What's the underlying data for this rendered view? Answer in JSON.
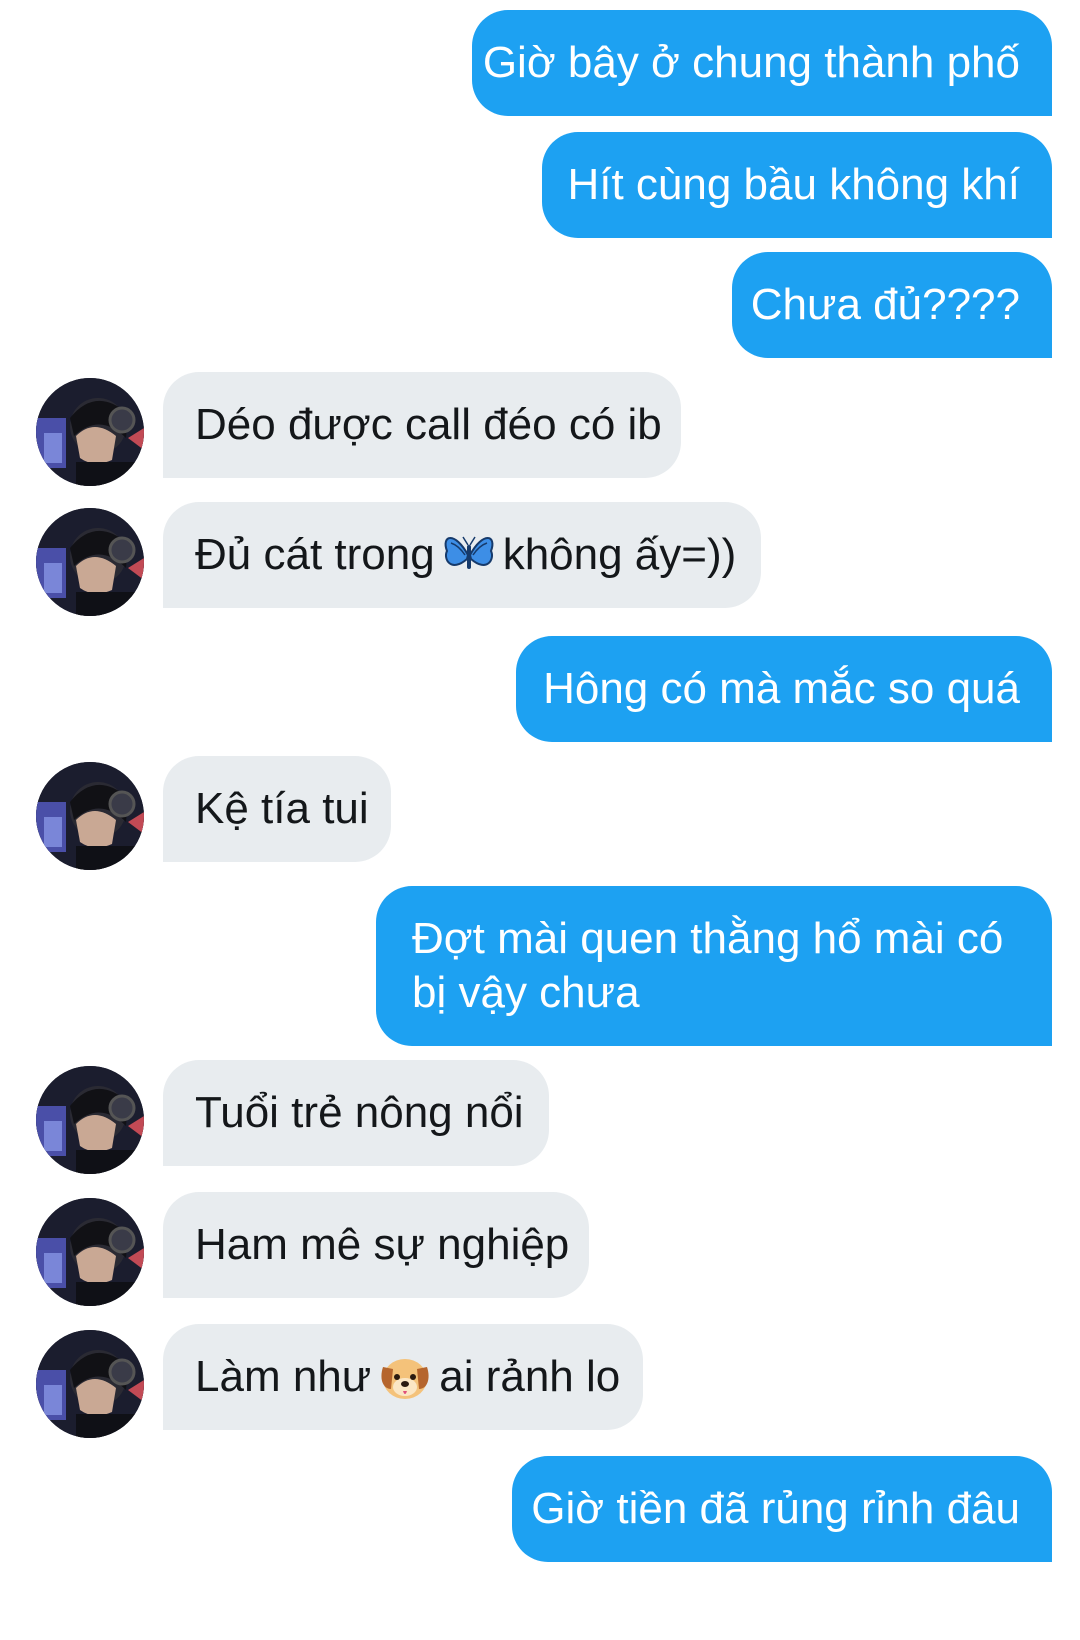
{
  "conversation": {
    "messages": [
      {
        "side": "out",
        "text": "Giờ bây ở chung thành phố"
      },
      {
        "side": "out",
        "text": "Hít cùng bầu không khí"
      },
      {
        "side": "out",
        "text": "Chưa đủ????"
      },
      {
        "side": "in",
        "text": "Déo được call đéo có ib"
      },
      {
        "side": "in",
        "text_before": "Đủ cát trong",
        "emoji": "butterfly-emoji",
        "text_after": "không ấy=))"
      },
      {
        "side": "out",
        "text": "Hông có mà mắc so quá"
      },
      {
        "side": "in",
        "text": "Kệ tía tui"
      },
      {
        "side": "out",
        "text": "Đợt mài quen thằng hổ mài có bị vậy chưa"
      },
      {
        "side": "in",
        "text": "Tuổi trẻ nông nổi"
      },
      {
        "side": "in",
        "text": "Ham mê sự nghiệp"
      },
      {
        "side": "in",
        "text_before": "Làm như",
        "emoji": "dog-face-emoji",
        "text_after": "ai rảnh lo"
      },
      {
        "side": "out",
        "text": "Giờ tiền đã rủng rỉnh đâu"
      }
    ]
  },
  "colors": {
    "outgoing_bubble": "#1da1f2",
    "outgoing_text": "#ffffff",
    "incoming_bubble": "#e8ecef",
    "incoming_text": "#14171a"
  }
}
